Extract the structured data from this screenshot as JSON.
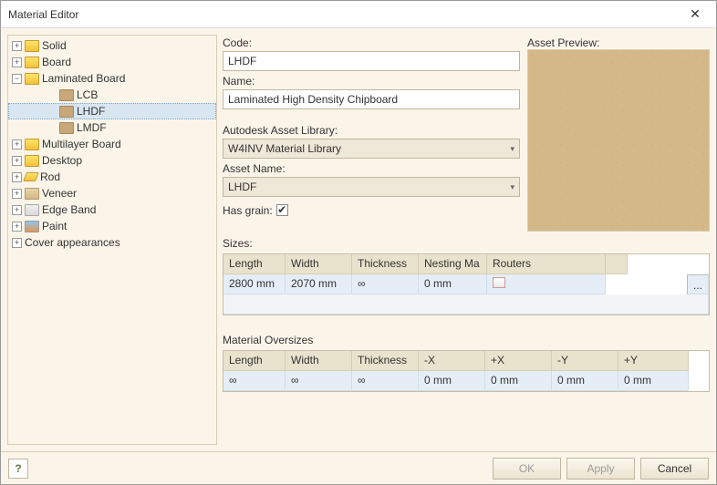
{
  "window": {
    "title": "Material Editor"
  },
  "tree": {
    "items": [
      {
        "label": "Solid",
        "exp": "+",
        "depth": 0,
        "icon": "f-yellow"
      },
      {
        "label": "Board",
        "exp": "+",
        "depth": 0,
        "icon": "f-yellow"
      },
      {
        "label": "Laminated Board",
        "exp": "−",
        "depth": 0,
        "icon": "f-yellow"
      },
      {
        "label": "LCB",
        "exp": "",
        "depth": 1,
        "icon": "f-tan"
      },
      {
        "label": "LHDF",
        "exp": "",
        "depth": 1,
        "icon": "f-tan",
        "selected": true
      },
      {
        "label": "LMDF",
        "exp": "",
        "depth": 1,
        "icon": "f-tan"
      },
      {
        "label": "Multilayer Board",
        "exp": "+",
        "depth": 0,
        "icon": "f-yellow"
      },
      {
        "label": "Desktop",
        "exp": "+",
        "depth": 0,
        "icon": "f-yellow"
      },
      {
        "label": "Rod",
        "exp": "+",
        "depth": 0,
        "icon": "f-rod"
      },
      {
        "label": "Veneer",
        "exp": "+",
        "depth": 0,
        "icon": "f-veneer"
      },
      {
        "label": "Edge Band",
        "exp": "+",
        "depth": 0,
        "icon": "f-edge"
      },
      {
        "label": "Paint",
        "exp": "+",
        "depth": 0,
        "icon": "f-paint"
      },
      {
        "label": "Cover appearances",
        "exp": "+",
        "depth": 0,
        "icon": ""
      }
    ]
  },
  "form": {
    "code_label": "Code:",
    "code_value": "LHDF",
    "name_label": "Name:",
    "name_value": "Laminated High Density Chipboard",
    "lib_label": "Autodesk Asset Library:",
    "lib_value": "W4INV Material Library",
    "asset_label": "Asset Name:",
    "asset_value": "LHDF",
    "hasgrain_label": "Has grain:",
    "hasgrain_checked": "✔",
    "preview_label": "Asset Preview:"
  },
  "sizes": {
    "title": "Sizes:",
    "headers": [
      "Length",
      "Width",
      "Thickness",
      "Nesting Ma",
      "Routers",
      ""
    ],
    "row": [
      "2800 mm",
      "2070 mm",
      "∞",
      "0 mm",
      "router",
      "..."
    ]
  },
  "oversizes": {
    "title": "Material Oversizes",
    "headers": [
      "Length",
      "Width",
      "Thickness",
      "-X",
      "+X",
      "-Y",
      "+Y"
    ],
    "row": [
      "∞",
      "∞",
      "∞",
      "0 mm",
      "0 mm",
      "0 mm",
      "0 mm"
    ]
  },
  "footer": {
    "ok": "OK",
    "apply": "Apply",
    "cancel": "Cancel"
  }
}
